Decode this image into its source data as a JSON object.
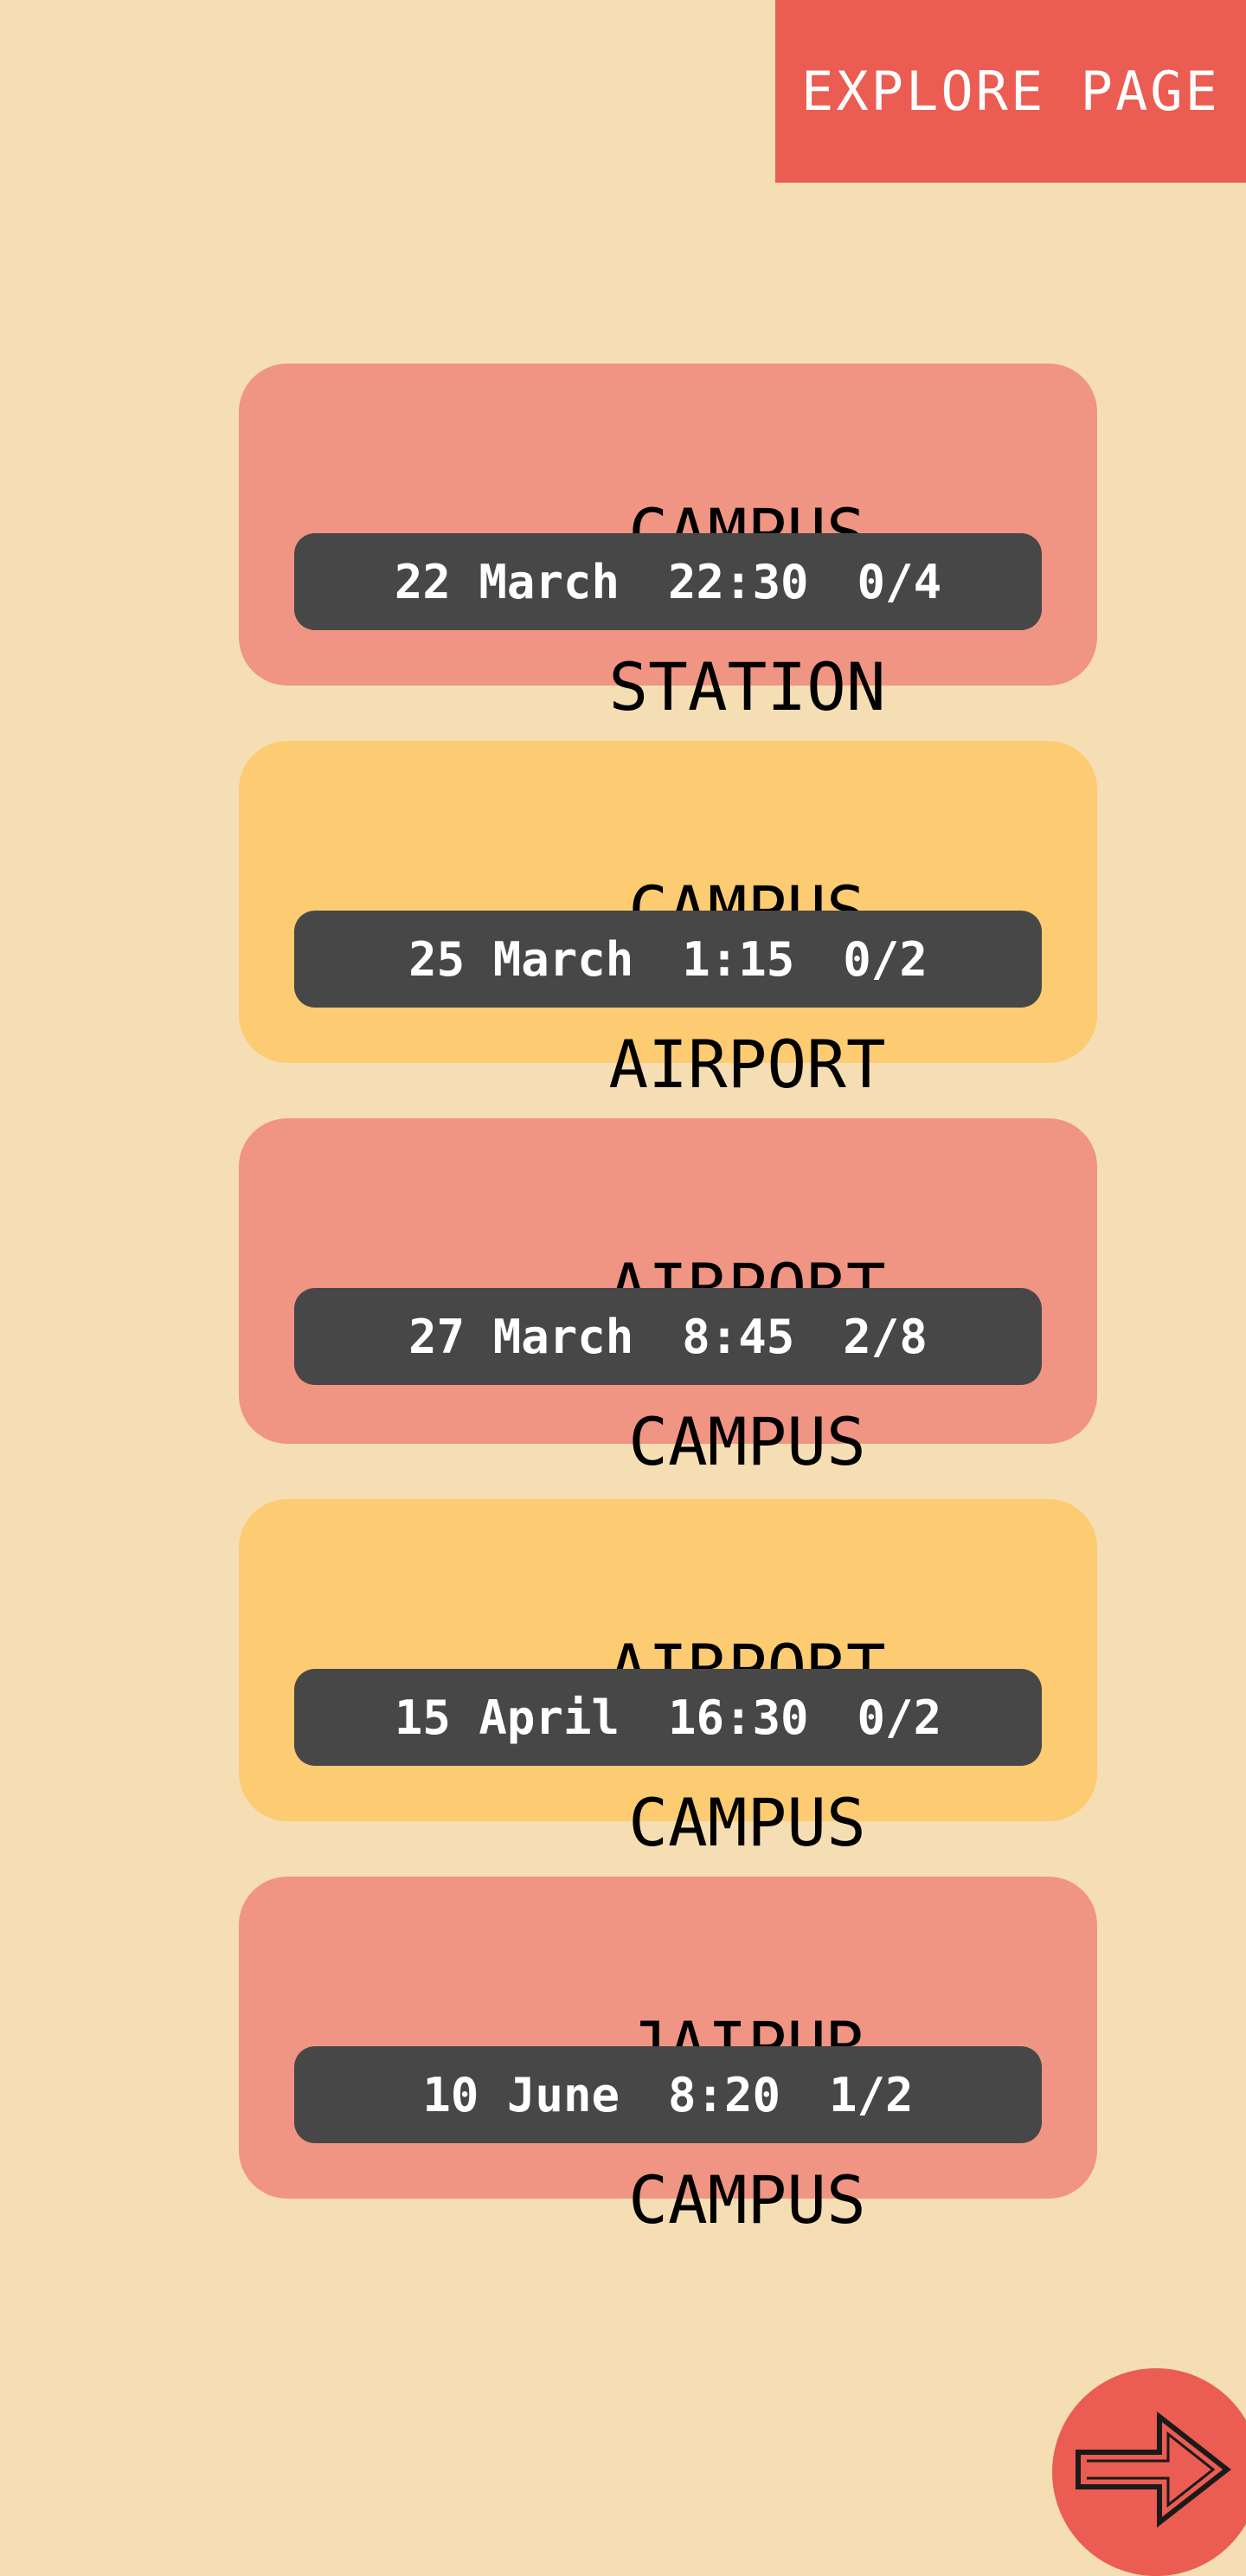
{
  "header": {
    "explore_label": "EXPLORE PAGE"
  },
  "rides": [
    {
      "from": "CAMPUS",
      "arrow": "→",
      "to": "STATION",
      "date": "22 March",
      "time": "22:30",
      "seats": "0/4",
      "color": "#f09483"
    },
    {
      "from": "CAMPUS",
      "arrow": "→",
      "to": "AIRPORT",
      "date": "25 March",
      "time": "1:15",
      "seats": "0/2",
      "color": "#fdcb72"
    },
    {
      "from": "AIRPORT",
      "arrow": "→",
      "to": "CAMPUS",
      "date": "27 March",
      "time": "8:45",
      "seats": "2/8",
      "color": "#f09483"
    },
    {
      "from": "AIRPORT",
      "arrow": "→",
      "to": "CAMPUS",
      "date": "15 April",
      "time": "16:30",
      "seats": "0/2",
      "color": "#fdcb72"
    },
    {
      "from": "JAIPUR",
      "arrow": "→",
      "to": "CAMPUS",
      "date": "10 June",
      "time": "8:20",
      "seats": "1/2",
      "color": "#f09483"
    }
  ],
  "next_button": {
    "icon": "arrow-right-icon"
  },
  "colors": {
    "background": "#f5deb3",
    "accent": "#eb5c52",
    "details_bg": "#474747"
  }
}
